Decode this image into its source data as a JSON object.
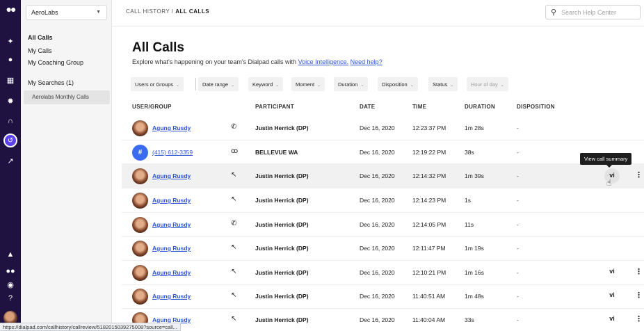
{
  "rail": {
    "icons": [
      "dialpad-logo-icon",
      "sparkle-icon",
      "person-icon",
      "building-icon",
      "settings-icon",
      "headset-icon",
      "history-icon",
      "analytics-icon",
      "bell-icon",
      "dialpad-small-icon",
      "user-circle-icon",
      "help-icon",
      "avatar"
    ]
  },
  "sidebar": {
    "org": "AeroLabs",
    "items": [
      {
        "label": "All Calls"
      },
      {
        "label": "My Calls"
      },
      {
        "label": "My Coaching Group"
      }
    ],
    "searches_label": "My Searches (1)",
    "saved_search": "Aerolabs Monthly Calls"
  },
  "header": {
    "breadcrumb_parent": "CALL HISTORY /",
    "breadcrumb_current": "ALL CALLS",
    "search_placeholder": "Search Help Center"
  },
  "main": {
    "title": "All Calls",
    "subtitle_prefix": "Explore what's happening on your team's Dialpad calls with ",
    "subtitle_link1": "Voice Intelligence.",
    "subtitle_link2": "Need help?"
  },
  "filters": [
    {
      "label": "Users or Groups"
    },
    {
      "label": "Date range"
    },
    {
      "label": "Keyword"
    },
    {
      "label": "Moment"
    },
    {
      "label": "Duration"
    },
    {
      "label": "Disposition"
    },
    {
      "label": "Status"
    },
    {
      "label": "Hour of day"
    }
  ],
  "columns": {
    "user": "USER/GROUP",
    "participant": "PARTICIPANT",
    "date": "DATE",
    "time": "TIME",
    "duration": "DURATION",
    "disposition": "DISPOSITION"
  },
  "rows": [
    {
      "user": "Agung Rusdy",
      "participant": "Justin Herrick (DP)",
      "date": "Dec 16, 2020",
      "time": "12:23:37 PM",
      "duration": "1m 28s",
      "disposition": "-",
      "vi": "",
      "kebab": ""
    },
    {
      "user": "(415) 612-3359",
      "avatar_text": "#",
      "participant": "BELLEVUE WA",
      "date": "Dec 16, 2020",
      "time": "12:19:22 PM",
      "duration": "38s",
      "disposition": "-",
      "vi": "",
      "kebab": ""
    },
    {
      "user": "Agung Rusdy",
      "participant": "Justin Herrick (DP)",
      "date": "Dec 16, 2020",
      "time": "12:14:32 PM",
      "duration": "1m 39s",
      "disposition": "-",
      "vi": "vi",
      "kebab": "⋮"
    },
    {
      "user": "Agung Rusdy",
      "participant": "Justin Herrick (DP)",
      "date": "Dec 16, 2020",
      "time": "12:14:23 PM",
      "duration": "1s",
      "disposition": "-",
      "vi": "",
      "kebab": ""
    },
    {
      "user": "Agung Rusdy",
      "participant": "Justin Herrick (DP)",
      "date": "Dec 16, 2020",
      "time": "12:14:05 PM",
      "duration": "11s",
      "disposition": "-",
      "vi": "",
      "kebab": ""
    },
    {
      "user": "Agung Rusdy",
      "participant": "Justin Herrick (DP)",
      "date": "Dec 16, 2020",
      "time": "12:11:47 PM",
      "duration": "1m 19s",
      "disposition": "-",
      "vi": "",
      "kebab": ""
    },
    {
      "user": "Agung Rusdy",
      "participant": "Justin Herrick (DP)",
      "date": "Dec 16, 2020",
      "time": "12:10:21 PM",
      "duration": "1m 16s",
      "disposition": "-",
      "vi": "vi",
      "kebab": "⋮"
    },
    {
      "user": "Agung Rusdy",
      "participant": "Justin Herrick (DP)",
      "date": "Dec 16, 2020",
      "time": "11:40:51 AM",
      "duration": "1m 48s",
      "disposition": "-",
      "vi": "vi",
      "kebab": "⋮"
    },
    {
      "user": "Agung Rusdy",
      "participant": "Justin Herrick (DP)",
      "date": "Dec 16, 2020",
      "time": "11:40:04 AM",
      "duration": "33s",
      "disposition": "-",
      "vi": "vi",
      "kebab": "⋮"
    }
  ],
  "tooltip": "View call summary",
  "status_url": "https://dialpad.com/callhistory/callreview/5182015039275008?source=call..."
}
